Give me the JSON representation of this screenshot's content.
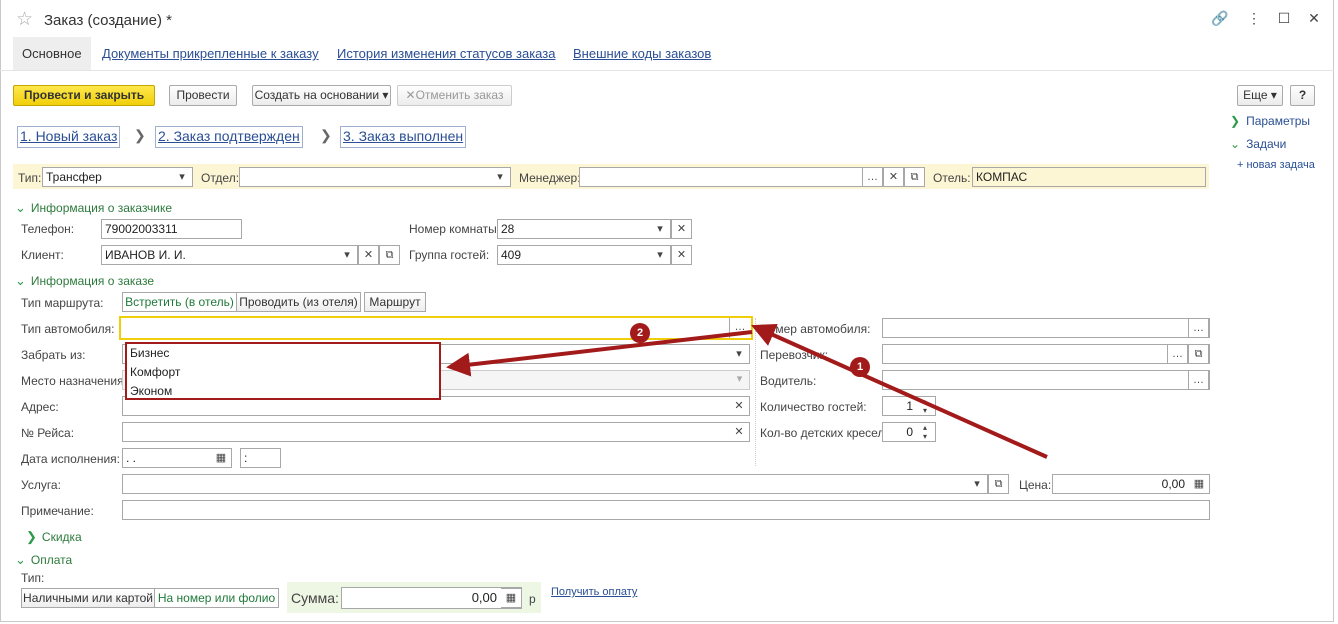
{
  "window": {
    "title": "Заказ (создание) *"
  },
  "tabs": [
    {
      "label": "Основное"
    },
    {
      "label": "Документы прикрепленные к заказу"
    },
    {
      "label": "История изменения статусов заказа"
    },
    {
      "label": "Внешние коды заказов"
    }
  ],
  "toolbar": {
    "post_close": "Провести и закрыть",
    "post": "Провести",
    "create_based": "Создать на основании",
    "cancel_order": "Отменить заказ",
    "more": "Еще",
    "help": "?"
  },
  "steps": [
    "1. Новый заказ",
    "2. Заказ подтвержден",
    "3. Заказ выполнен"
  ],
  "right_panel": {
    "params": "Параметры",
    "tasks": "Задачи",
    "new_task": "+ новая задача"
  },
  "header": {
    "type_label": "Тип:",
    "type_value": "Трансфер",
    "dept_label": "Отдел:",
    "dept_value": "",
    "manager_label": "Менеджер:",
    "manager_value": "",
    "hotel_label": "Отель:",
    "hotel_value": "КОМПАС"
  },
  "customer": {
    "section": "Информация о заказчике",
    "phone_label": "Телефон:",
    "phone_value": "79002003311",
    "room_label": "Номер комнаты:",
    "room_value": "28",
    "client_label": "Клиент:",
    "client_value": "ИВАНОВ И. И.",
    "group_label": "Группа гостей:",
    "group_value": "409"
  },
  "order": {
    "section": "Информация о заказе",
    "route_label": "Тип маршрута:",
    "route_options": [
      "Встретить (в отель)",
      "Проводить (из отеля)",
      "Маршрут"
    ],
    "car_type_label": "Тип автомобиля:",
    "car_type_options": [
      "Бизнес",
      "Комфорт",
      "Эконом"
    ],
    "pickup_label": "Забрать из:",
    "destination_label": "Место назначения:",
    "address_label": "Адрес:",
    "flight_label": "№ Рейса:",
    "date_label": "Дата исполнения:",
    "date_value": " .  .",
    "time_value": " :",
    "car_number_label": "Номер автомобиля:",
    "carrier_label": "Перевозчик:",
    "driver_label": "Водитель:",
    "guests_label": "Количество гостей:",
    "guests_value": "1",
    "child_seats_label": "Кол-во детских кресел:",
    "child_seats_value": "0",
    "service_label": "Услуга:",
    "price_label": "Цена:",
    "price_value": "0,00",
    "note_label": "Примечание:",
    "discount_section": "Скидка"
  },
  "payment": {
    "section": "Оплата",
    "type_label": "Тип:",
    "options": [
      "Наличными или картой",
      "На номер или фолио"
    ],
    "sum_label": "Сумма:",
    "sum_value": "0,00",
    "currency": "р",
    "get_payment": "Получить оплату"
  },
  "annotations": {
    "badge1": "1",
    "badge2": "2"
  },
  "colors": {
    "accent_yellow": "#f0cf0a",
    "link": "#2a4f94",
    "green": "#2d7a3c",
    "annotation_red": "#a31a1a"
  }
}
